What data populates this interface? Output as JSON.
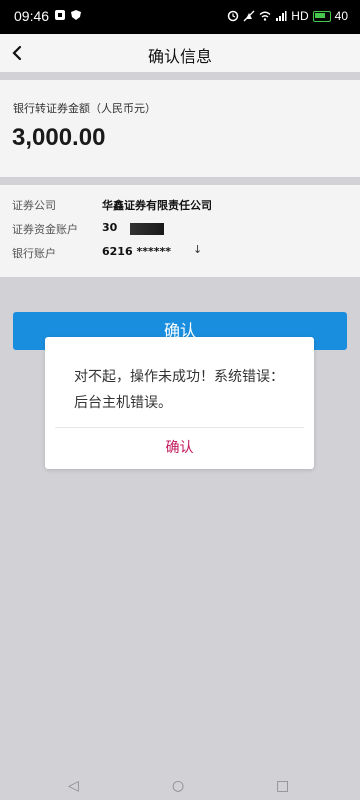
{
  "status": {
    "time": "09:46",
    "network": "HD",
    "battery": "40"
  },
  "nav": {
    "title": "确认信息",
    "back_icon": "chevron-left-icon"
  },
  "amount": {
    "label": "银行转证券金额（人民币元）",
    "value": "3,000.00"
  },
  "info": {
    "rows": [
      {
        "key": "证券公司",
        "value": "华鑫证券有限责任公司"
      },
      {
        "key": "证券资金账户",
        "value": "30"
      },
      {
        "key": "银行账户",
        "value": "6216 ******"
      }
    ]
  },
  "primary_button": {
    "label": "确认"
  },
  "dialog": {
    "message_line1": "对不起，操作未成功！系统错误：",
    "message_line2": "后台主机错误。",
    "ok_label": "确认"
  },
  "system_nav": {
    "back": "◁",
    "home": "○",
    "recents": "□"
  },
  "colors": {
    "accent": "#1a8ede",
    "dialog_action": "#c2185b"
  }
}
